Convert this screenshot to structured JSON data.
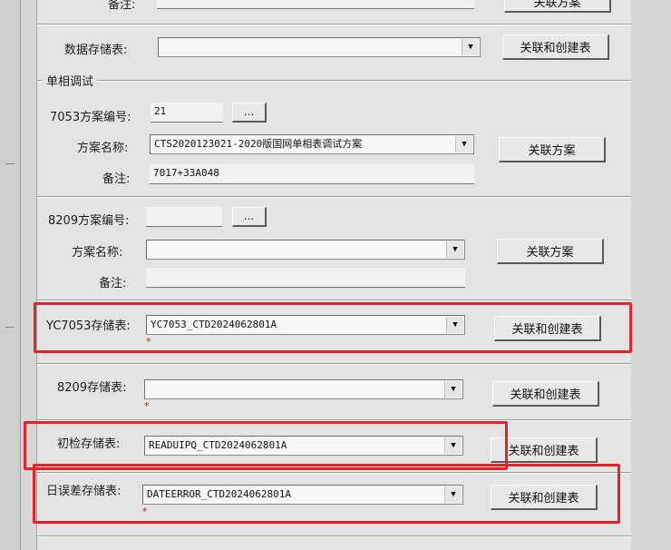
{
  "top_row": {
    "label": "备注:",
    "button": "关联方案"
  },
  "data_table": {
    "label": "数据存储表:",
    "value": "",
    "button": "关联和创建表"
  },
  "single_phase": {
    "title": "单相调试",
    "scheme_7053": {
      "id_label": "7053方案编号:",
      "id_value": "21",
      "browse": "...",
      "name_label": "方案名称:",
      "name_value": "CTS2020123021-2020版国网单相表调试方案",
      "remark_label": "备注:",
      "remark_value": "7017+33A048",
      "button": "关联方案"
    },
    "scheme_8209": {
      "id_label": "8209方案编号:",
      "id_value": "",
      "browse": "...",
      "name_label": "方案名称:",
      "name_value": "",
      "remark_label": "备注:",
      "remark_value": "",
      "button": "关联方案"
    }
  },
  "storage": [
    {
      "label": "YC7053存储表:",
      "value": "YC7053_CTD2024062801A",
      "button": "关联和创建表",
      "required": "*"
    },
    {
      "label": "8209存储表:",
      "value": "",
      "button": "关联和创建表",
      "required": "*"
    },
    {
      "label": "初检存储表:",
      "value": "READUIPQ_CTD2024062801A",
      "button": "关联和创建表",
      "required": ""
    },
    {
      "label": "日误差存储表:",
      "value": "DATEERROR_CTD2024062801A",
      "button": "关联和创建表",
      "required": "*"
    }
  ],
  "icons": {
    "dropdown": "chevron-down-icon"
  },
  "colors": {
    "highlight": "#e8202a",
    "required": "#c42020"
  }
}
